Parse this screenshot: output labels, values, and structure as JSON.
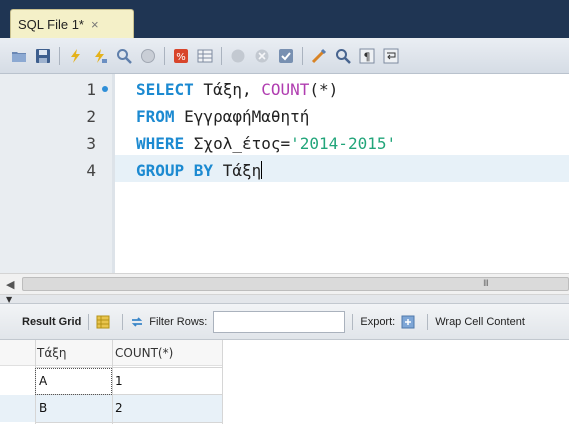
{
  "tab": {
    "title": "SQL File 1*",
    "close_glyph": "×"
  },
  "toolbar": {
    "icons": [
      "open-folder-icon",
      "save-icon",
      "execute-icon",
      "execute-current-icon",
      "explain-icon",
      "stop-icon",
      "toggle-error-icon",
      "commit-icon",
      "rollback-icon",
      "autocommit-icon",
      "beautify-icon",
      "find-icon",
      "invisible-chars-icon",
      "wrap-icon"
    ]
  },
  "editor": {
    "lines": [
      {
        "number": "1",
        "has_marker": true,
        "tokens": [
          {
            "t": "SELECT",
            "c": "kw"
          },
          {
            "t": " Τάξη, ",
            "c": ""
          },
          {
            "t": "COUNT",
            "c": "fn"
          },
          {
            "t": "(*)",
            "c": ""
          }
        ]
      },
      {
        "number": "2",
        "has_marker": false,
        "tokens": [
          {
            "t": "FROM",
            "c": "kw"
          },
          {
            "t": " ΕγγραφήΜαθητή",
            "c": ""
          }
        ]
      },
      {
        "number": "3",
        "has_marker": false,
        "tokens": [
          {
            "t": "WHERE",
            "c": "kw"
          },
          {
            "t": " Σχολ_έτος=",
            "c": ""
          },
          {
            "t": "'2014-2015'",
            "c": "str"
          }
        ]
      },
      {
        "number": "4",
        "has_marker": false,
        "tokens": [
          {
            "t": "GROUP BY",
            "c": "kw"
          },
          {
            "t": " Τάξη",
            "c": ""
          }
        ]
      }
    ]
  },
  "scrollbar": {
    "grip": "III"
  },
  "result_toolbar": {
    "result_grid_label": "Result Grid",
    "filter_rows_label": "Filter Rows:",
    "filter_value": "",
    "export_label": "Export:",
    "wrap_label": "Wrap Cell Content"
  },
  "grid": {
    "columns": [
      "Τάξη",
      "COUNT(*)"
    ],
    "rows": [
      [
        "A",
        "1"
      ],
      [
        "B",
        "2"
      ]
    ]
  },
  "colors": {
    "tab_strip": "#1f3553",
    "keyword": "#1c8ad1",
    "function": "#b03db0",
    "string": "#22a57a",
    "selected_row": "#e8f1f8"
  }
}
